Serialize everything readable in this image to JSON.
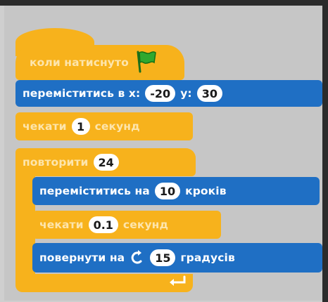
{
  "script": {
    "when_clicked": {
      "label": "коли натиснуто",
      "icon": "green-flag-icon"
    },
    "goto": {
      "label": "переміститись в x:",
      "x": "-20",
      "y_label": "y:",
      "y": "30"
    },
    "wait1": {
      "label": "чекати",
      "value": "1",
      "unit": "секунд"
    },
    "repeat": {
      "label": "повторити",
      "value": "24"
    },
    "move": {
      "label": "переміститись на",
      "value": "10",
      "unit": "кроків"
    },
    "wait2": {
      "label": "чекати",
      "value": "0.1",
      "unit": "секунд"
    },
    "turn": {
      "label": "повернути на",
      "icon": "rotate-left-icon",
      "value": "15",
      "unit": "градусів"
    },
    "loop_end": {
      "icon": "return-arrow-icon"
    }
  },
  "colors": {
    "motion": "#1f6fc4",
    "control": "#f7b21c",
    "flag": "#2fa82f"
  }
}
